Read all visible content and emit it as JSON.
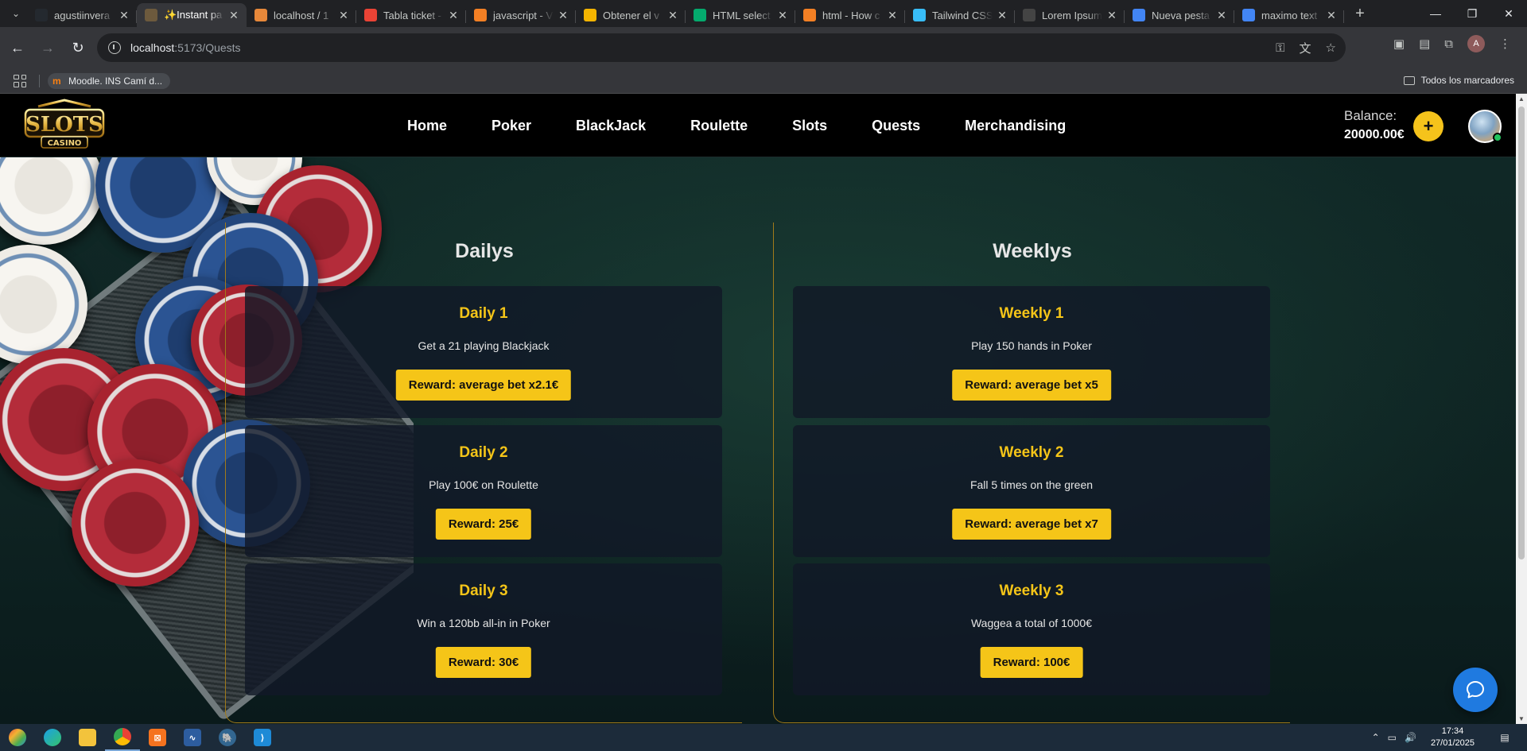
{
  "browser": {
    "tabs": [
      {
        "title": "agustiinvera",
        "favicon": "github-icon",
        "color": "#24292f"
      },
      {
        "title": "✨Instant pa",
        "favicon": "game-icon",
        "color": "#6d5a3d",
        "active": true
      },
      {
        "title": "localhost / 1",
        "favicon": "phpmyadmin-icon",
        "color": "#e7883a"
      },
      {
        "title": "Tabla ticket -",
        "favicon": "gmail-icon",
        "color": "#ea4335"
      },
      {
        "title": "javascript - V",
        "favicon": "stackoverflow-icon",
        "color": "#f48024"
      },
      {
        "title": "Obtener el v",
        "favicon": "docs-icon",
        "color": "#f4b400"
      },
      {
        "title": "HTML select",
        "favicon": "w3schools-icon",
        "color": "#04aa6d"
      },
      {
        "title": "html - How c",
        "favicon": "stackoverflow-icon",
        "color": "#f48024"
      },
      {
        "title": "Tailwind CSS",
        "favicon": "tailwind-icon",
        "color": "#38bdf8"
      },
      {
        "title": "Lorem Ipsum",
        "favicon": "lorem-icon",
        "color": "#444444"
      },
      {
        "title": "Nueva pesta",
        "favicon": "chrome-icon",
        "color": "#4285f4"
      },
      {
        "title": "maximo text",
        "favicon": "google-icon",
        "color": "#4285f4"
      }
    ],
    "url_host": "localhost",
    "url_path": ":5173/Quests",
    "bookmarks": [
      {
        "label": "Moodle. INS Camí d..."
      }
    ],
    "all_bookmarks_label": "Todos los marcadores",
    "profile_initial": "A"
  },
  "site": {
    "logo_text_top": "SLOTS",
    "logo_text_bottom": "CASINO",
    "nav": [
      "Home",
      "Poker",
      "BlackJack",
      "Roulette",
      "Slots",
      "Quests",
      "Merchandising"
    ],
    "balance_label": "Balance:",
    "balance_value": "20000.00€",
    "add_funds_label": "+"
  },
  "quests": {
    "dailys": {
      "title": "Dailys",
      "items": [
        {
          "title": "Daily 1",
          "desc": "Get a 21 playing Blackjack",
          "reward": "Reward: average bet x2.1€"
        },
        {
          "title": "Daily 2",
          "desc": "Play 100€ on Roulette",
          "reward": "Reward: 25€"
        },
        {
          "title": "Daily 3",
          "desc": "Win a 120bb all-in in Poker",
          "reward": "Reward: 30€"
        }
      ]
    },
    "weeklys": {
      "title": "Weeklys",
      "items": [
        {
          "title": "Weekly 1",
          "desc": "Play 150 hands in Poker",
          "reward": "Reward: average bet x5"
        },
        {
          "title": "Weekly 2",
          "desc": "Fall 5 times on the green",
          "reward": "Reward: average bet x7"
        },
        {
          "title": "Weekly 3",
          "desc": "Waggea a total of 1000€",
          "reward": "Reward: 100€"
        }
      ]
    }
  },
  "taskbar": {
    "time": "17:34",
    "date": "27/01/2025"
  },
  "colors": {
    "accent": "#f5c518",
    "chat": "#1f7ae0",
    "card_bg": "#111827"
  }
}
